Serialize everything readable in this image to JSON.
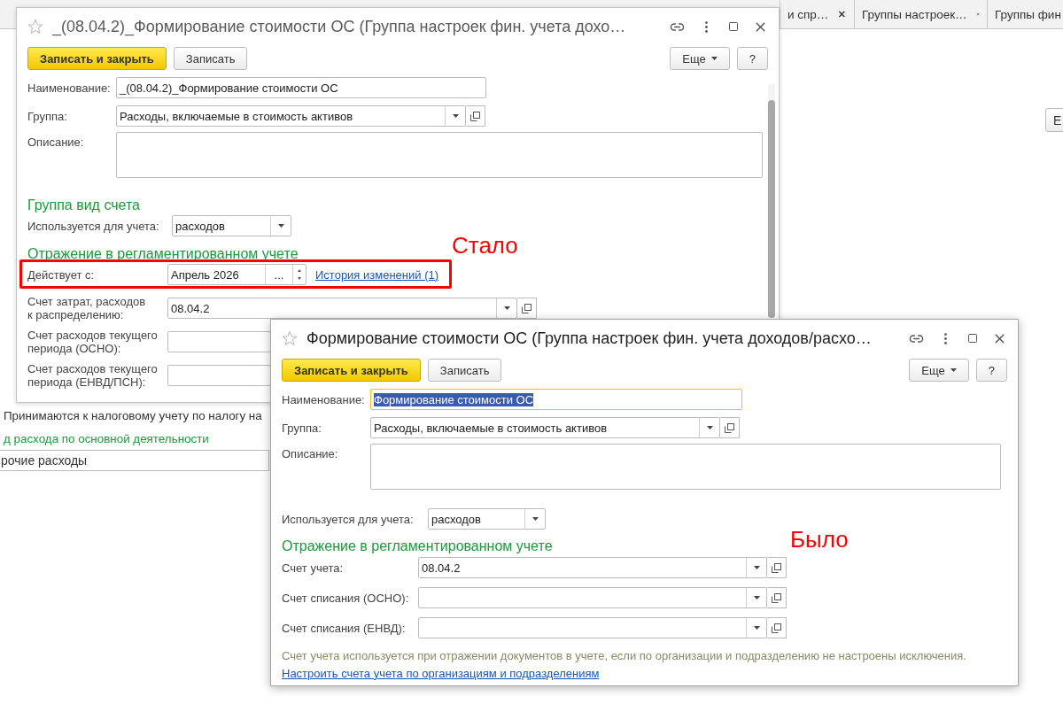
{
  "tab_strip": {
    "tabs": [
      {
        "label": "и спр…",
        "closable": true
      },
      {
        "label": "Группы настроек…",
        "closable": true
      },
      {
        "label": "Группы фин"
      }
    ]
  },
  "background": {
    "side_button": "Е",
    "checkbox_text": "Принимаются к налоговому учету по налогу на",
    "section_text": "д расхода по основной деятельности",
    "field_value": "рочие расходы"
  },
  "windows": [
    {
      "title": "_(08.04.2)_Формирование стоимости ОС (Группа настроек фин. учета дохо…",
      "active": false,
      "scrollbar": true,
      "buttons": {
        "primary": "Записать и закрыть",
        "secondary": "Записать",
        "more": "Еще",
        "help": "?"
      },
      "fields": [
        {
          "kind": "text",
          "label": "Наименование:",
          "value": "_(08.04.2)_Формирование стоимости ОС",
          "focused": false,
          "text_selected": false
        },
        {
          "kind": "select",
          "label": "Группа:",
          "value": "Расходы, включаемые в стоимость активов",
          "open_button": true
        },
        {
          "kind": "textarea",
          "label": "Описание:"
        },
        {
          "kind": "section",
          "text": "Группа вид счета"
        },
        {
          "kind": "select",
          "label": "Используется для учета:",
          "value": "расходов",
          "open_button": false
        },
        {
          "kind": "section",
          "text": "Отражение в регламентированном учете"
        },
        {
          "kind": "period",
          "label": "Действует с:",
          "value": "Апрель 2026",
          "chooser": "...",
          "link": "История изменений (1)"
        },
        {
          "kind": "select",
          "label": "Счет затрат, расходов\nк распределению:",
          "value": "08.04.2",
          "open_button": true
        },
        {
          "kind": "select",
          "label": "Счет расходов текущего\nпериода (ОСНО):",
          "open_button": false
        },
        {
          "kind": "select",
          "label": "Счет расходов текущего\nпериода (ЕНВД/ПСН):",
          "open_button": false
        }
      ]
    },
    {
      "title": "Формирование стоимости ОС (Группа настроек фин. учета доходов/расхо…",
      "active": true,
      "scrollbar": false,
      "buttons": {
        "primary": "Записать и закрыть",
        "secondary": "Записать",
        "more": "Еще",
        "help": "?"
      },
      "fields": [
        {
          "kind": "text",
          "label": "Наименование:",
          "value": "Формирование стоимости ОС",
          "focused": true,
          "text_selected": true
        },
        {
          "kind": "select",
          "label": "Группа:",
          "value": "Расходы, включаемые в стоимость активов",
          "open_button": true
        },
        {
          "kind": "textarea",
          "label": "Описание:"
        },
        {
          "kind": "select",
          "label": "Используется для учета:",
          "value": "расходов",
          "open_button": false
        },
        {
          "kind": "section",
          "text": "Отражение в регламентированном учете"
        },
        {
          "kind": "select",
          "label": "Счет учета:",
          "value": "08.04.2",
          "open_button": true
        },
        {
          "kind": "select",
          "label": "Счет списания (ОСНО):",
          "open_button": true
        },
        {
          "kind": "select",
          "label": "Счет списания (ЕНВД):",
          "open_button": true
        },
        {
          "kind": "note",
          "text": "Счет учета используется при отражении документов в учете, если по организации и подразделению не настроены исключения."
        },
        {
          "kind": "link",
          "text": "Настроить счета учета по организациям и подразделениям"
        }
      ]
    }
  ],
  "annotations": [
    {
      "kind": "frame"
    },
    {
      "kind": "label",
      "text": "Стало"
    },
    {
      "kind": "label",
      "text": "Было"
    }
  ]
}
